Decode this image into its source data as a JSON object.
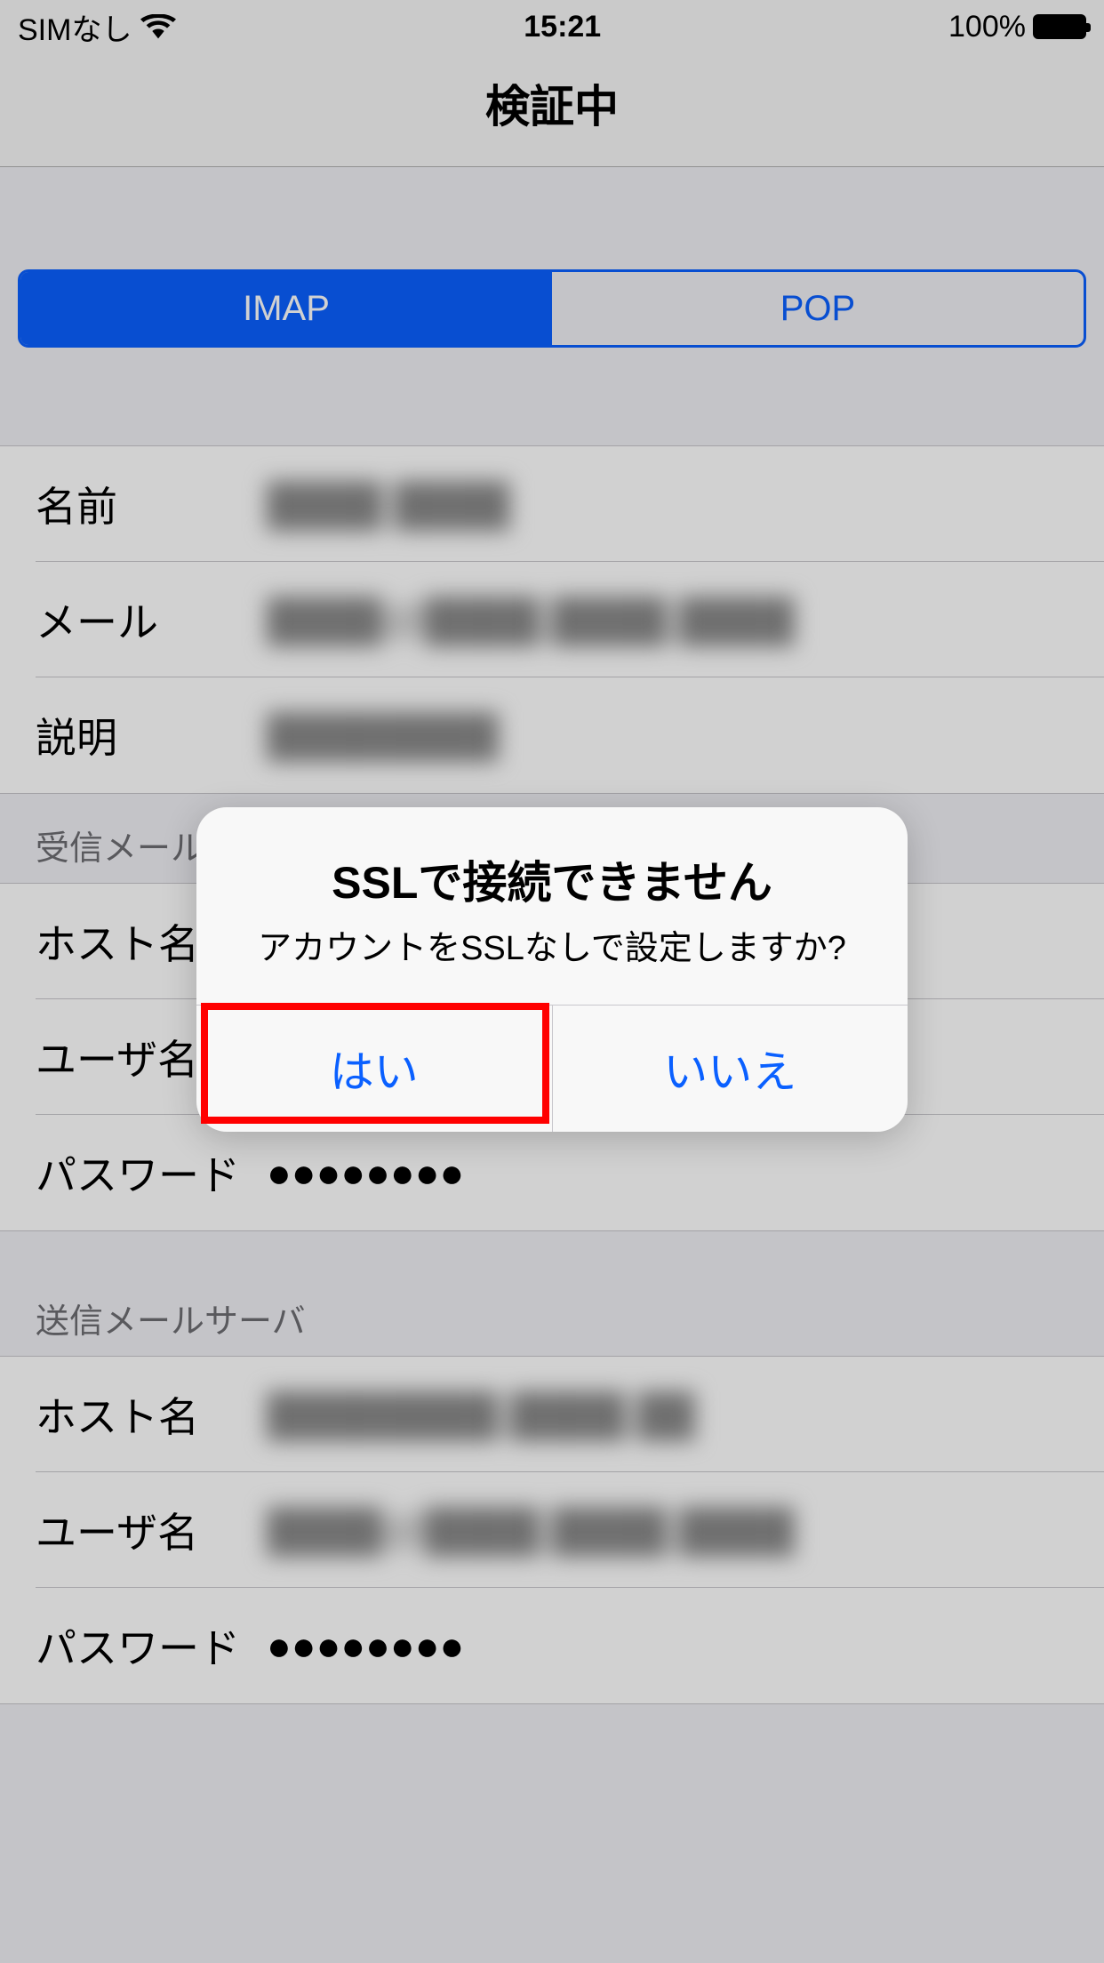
{
  "status": {
    "carrier": "SIMなし",
    "time": "15:21",
    "battery_pct": "100%"
  },
  "header": {
    "title": "検証中"
  },
  "segments": {
    "imap": "IMAP",
    "pop": "POP"
  },
  "account_section": {
    "name_label": "名前",
    "name_value": "████ ████",
    "mail_label": "メール",
    "mail_value": "████@████.████.████",
    "desc_label": "説明",
    "desc_value": "████████"
  },
  "incoming_section": {
    "header": "受信メールサーバ",
    "host_label": "ホスト名",
    "host_value": "████████.████.██",
    "user_label": "ユーザ名",
    "user_value": "████@████.████.████",
    "pass_label": "パスワード",
    "pass_value": "●●●●●●●●"
  },
  "outgoing_section": {
    "header": "送信メールサーバ",
    "host_label": "ホスト名",
    "host_value": "████████.████.██",
    "user_label": "ユーザ名",
    "user_value": "████@████.████.████",
    "pass_label": "パスワード",
    "pass_value": "●●●●●●●●"
  },
  "alert": {
    "title": "SSLで接続できません",
    "msg": "アカウントをSSLなしで設定しますか?",
    "yes": "はい",
    "no": "いいえ"
  }
}
